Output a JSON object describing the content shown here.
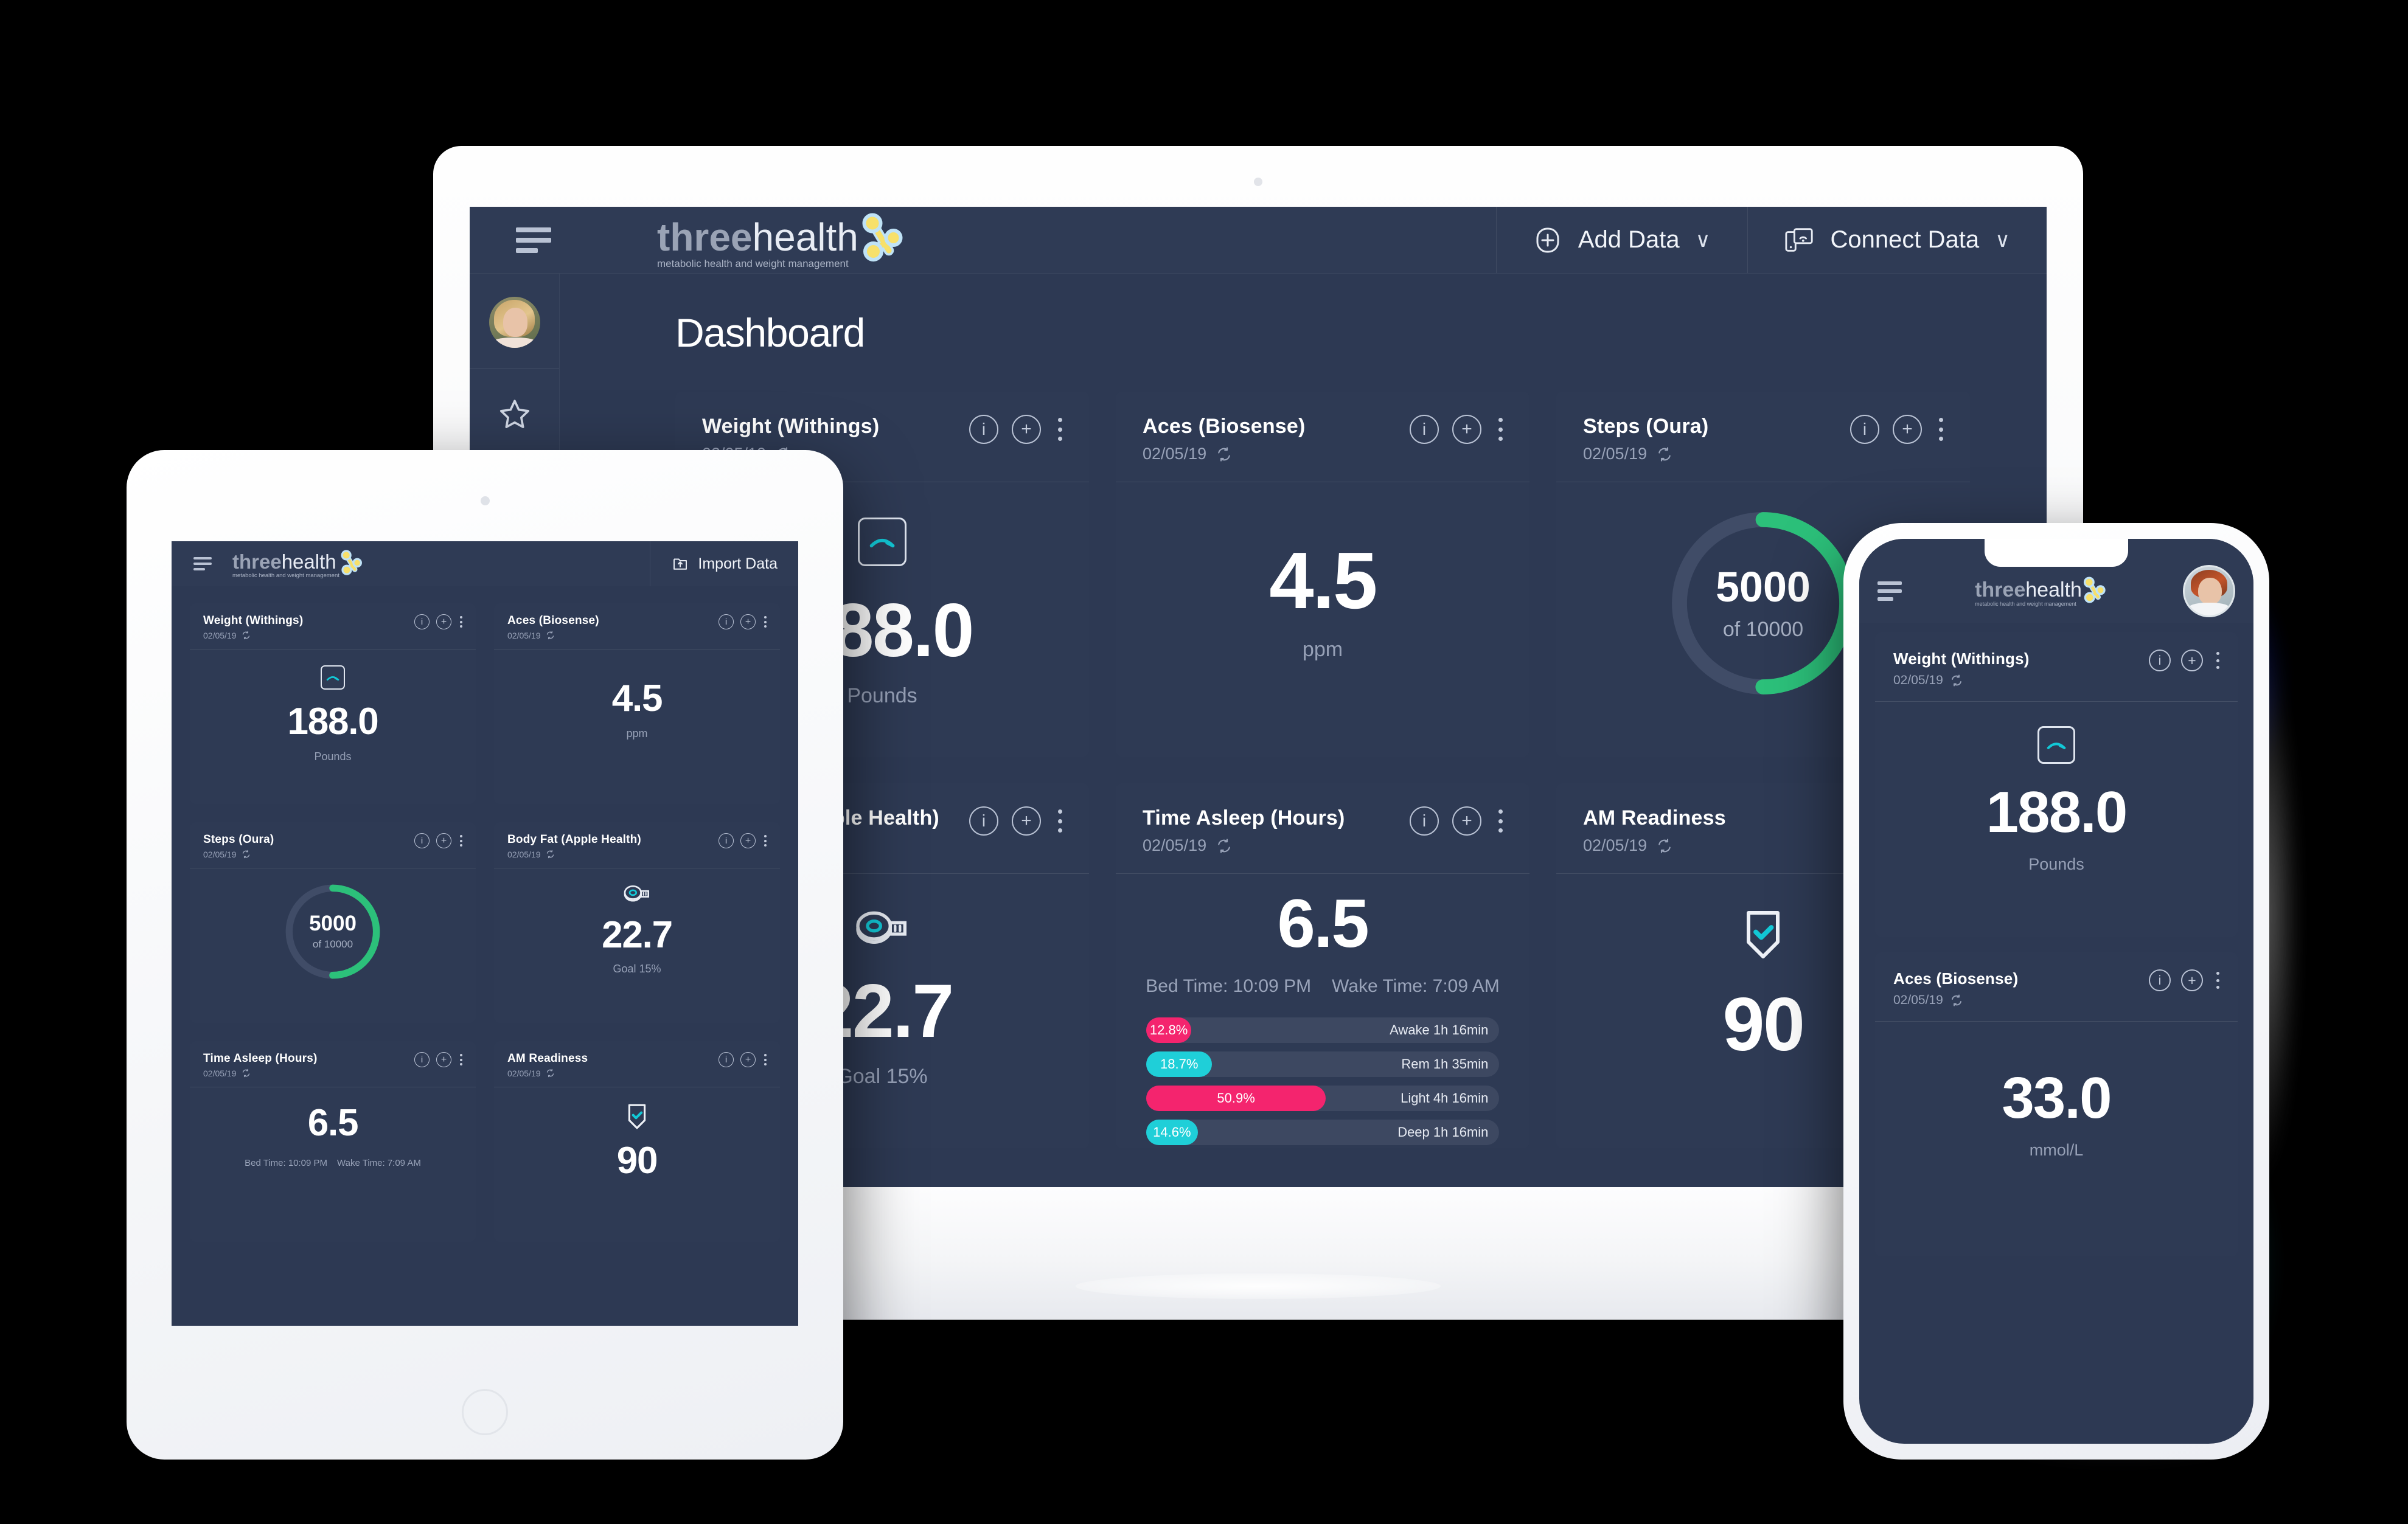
{
  "brand": {
    "name_bold": "three",
    "name_light": "health",
    "tagline": "metabolic health and weight management",
    "logo_icon": "molecule-logo-icon",
    "accent_cyan": "#00c2d4",
    "accent_green": "#2cc07a",
    "accent_pink": "#f4246e",
    "bg_navy": "#2d3953",
    "card_navy": "#2e3a54"
  },
  "desktop": {
    "menu_icon": "hamburger-menu-icon",
    "page_title": "Dashboard",
    "toolbar": [
      {
        "icon": "plus-circle-icon",
        "label": "Add Data",
        "caret": "∨"
      },
      {
        "icon": "connect-devices-icon",
        "label": "Connect Data",
        "caret": "∨"
      }
    ],
    "sidebar": {
      "avatar": "user-avatar",
      "items": [
        {
          "icon": "star-icon",
          "name": "favorites"
        }
      ],
      "active_indicator_color": "#00c2d4"
    },
    "cards": [
      {
        "title": "Weight (Withings)",
        "date": "02/05/19",
        "sync_icon": "sync-icon",
        "icon": "scale-icon",
        "value": "188.0",
        "unit": "Pounds",
        "type": "value"
      },
      {
        "title": "Aces (Biosense)",
        "date": "02/05/19",
        "sync_icon": "sync-icon",
        "value": "4.5",
        "unit": "ppm",
        "type": "value"
      },
      {
        "title": "Steps (Oura)",
        "date": "02/05/19",
        "sync_icon": "sync-icon",
        "type": "gauge",
        "value": "5000",
        "goal_label": "of 10000",
        "percent": 50,
        "arc_color": "#2cc07a"
      },
      {
        "title": "Body Fat (Apple Health)",
        "date": "02/05/19",
        "sync_icon": "sync-icon",
        "icon": "tape-measure-icon",
        "value": "22.7",
        "unit": "Goal 15%",
        "type": "value"
      },
      {
        "title": "Time Asleep (Hours)",
        "date": "02/05/19",
        "sync_icon": "sync-icon",
        "type": "sleep",
        "value": "6.5",
        "bed_time": "Bed Time: 10:09 PM",
        "wake_time": "Wake Time: 7:09 AM",
        "stages": [
          {
            "pct": "12.8%",
            "width": 12.8,
            "label": "Awake 1h 16min",
            "color": "#f4246e"
          },
          {
            "pct": "18.7%",
            "width": 18.7,
            "label": "Rem 1h 35min",
            "color": "#1fcfd8"
          },
          {
            "pct": "50.9%",
            "width": 50.9,
            "label": "Light 4h 16min",
            "color": "#f4246e"
          },
          {
            "pct": "14.6%",
            "width": 14.6,
            "label": "Deep 1h 16min",
            "color": "#1fcfd8"
          }
        ]
      },
      {
        "title": "AM Readiness",
        "date": "02/05/19",
        "sync_icon": "sync-icon",
        "icon": "shield-check-icon",
        "value": "90",
        "unit": "",
        "type": "value"
      }
    ]
  },
  "tablet": {
    "menu_icon": "hamburger-menu-icon",
    "import_button": {
      "icon": "import-folder-icon",
      "label": "Import Data"
    },
    "cards": [
      {
        "title": "Weight (Withings)",
        "date": "02/05/19",
        "sync_icon": "sync-icon",
        "icon": "scale-icon",
        "value": "188.0",
        "unit": "Pounds",
        "type": "value"
      },
      {
        "title": "Aces (Biosense)",
        "date": "02/05/19",
        "sync_icon": "sync-icon",
        "value": "4.5",
        "unit": "ppm",
        "type": "value"
      },
      {
        "title": "Steps (Oura)",
        "date": "02/05/19",
        "sync_icon": "sync-icon",
        "type": "gauge",
        "value": "5000",
        "goal_label": "of 10000",
        "percent": 50,
        "arc_color": "#2cc07a"
      },
      {
        "title": "Body Fat (Apple Health)",
        "date": "02/05/19",
        "sync_icon": "sync-icon",
        "icon": "tape-measure-icon",
        "value": "22.7",
        "unit": "Goal 15%",
        "type": "value"
      },
      {
        "title": "Time Asleep (Hours)",
        "date": "02/05/19",
        "sync_icon": "sync-icon",
        "type": "sleep-mini",
        "value": "6.5",
        "bed_time": "Bed Time: 10:09 PM",
        "wake_time": "Wake Time: 7:09 AM"
      },
      {
        "title": "AM Readiness",
        "date": "02/05/19",
        "sync_icon": "sync-icon",
        "icon": "shield-check-icon",
        "value": "90",
        "type": "value"
      }
    ]
  },
  "phone": {
    "menu_icon": "hamburger-menu-icon",
    "avatar": "user-avatar",
    "cards": [
      {
        "title": "Weight (Withings)",
        "date": "02/05/19",
        "sync_icon": "sync-icon",
        "icon": "scale-icon",
        "value": "188.0",
        "unit": "Pounds"
      },
      {
        "title": "Aces (Biosense)",
        "date": "02/05/19",
        "sync_icon": "sync-icon",
        "value": "33.0",
        "unit": "mmol/L"
      }
    ]
  }
}
